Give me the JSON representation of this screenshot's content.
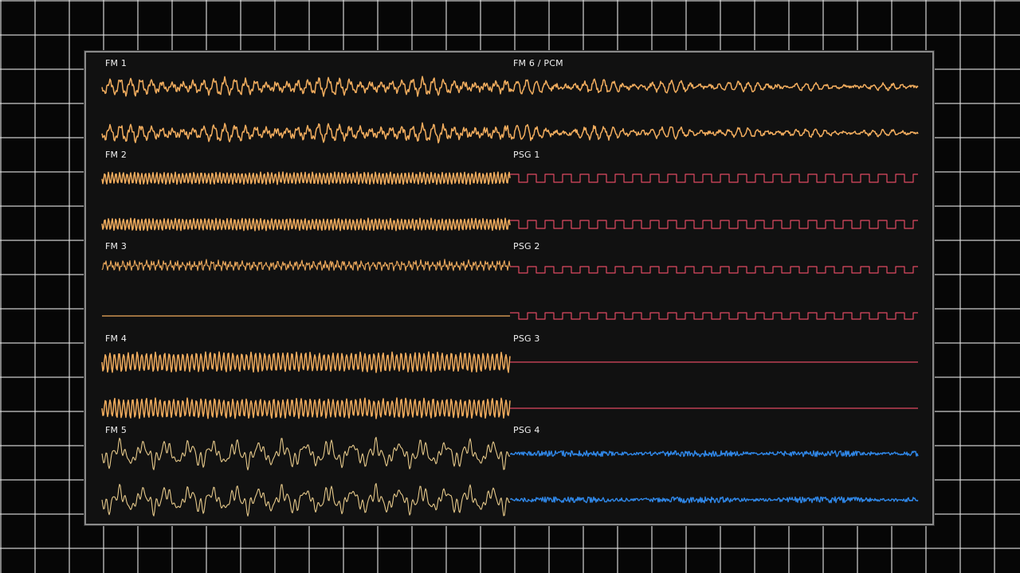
{
  "colors": {
    "fm": "#f2ad5e",
    "fm5": "#e6c98a",
    "psg_square": "#e04a62",
    "psg_noise": "#2f86e6",
    "label": "#f0f0f0",
    "panel": "#111111",
    "grid": "#dcdcdc"
  },
  "channels": [
    {
      "label": "FM 1",
      "kind": "fm-dense",
      "tracks": 2
    },
    {
      "label": "FM 2",
      "kind": "fm-tight",
      "tracks": 2
    },
    {
      "label": "FM 3",
      "kind": "fm-spiky",
      "tracks": 2,
      "second_track_flat": true
    },
    {
      "label": "FM 4",
      "kind": "fm-heavy",
      "tracks": 2
    },
    {
      "label": "FM 5",
      "kind": "fm-wave",
      "tracks": 2
    },
    {
      "label": "FM 6 / PCM",
      "kind": "fm-decay",
      "tracks": 2
    },
    {
      "label": "PSG 1",
      "kind": "square",
      "tracks": 2
    },
    {
      "label": "PSG 2",
      "kind": "square-small",
      "tracks": 2
    },
    {
      "label": "PSG 3",
      "kind": "flat",
      "tracks": 2
    },
    {
      "label": "PSG 4",
      "kind": "noise",
      "tracks": 2
    }
  ]
}
